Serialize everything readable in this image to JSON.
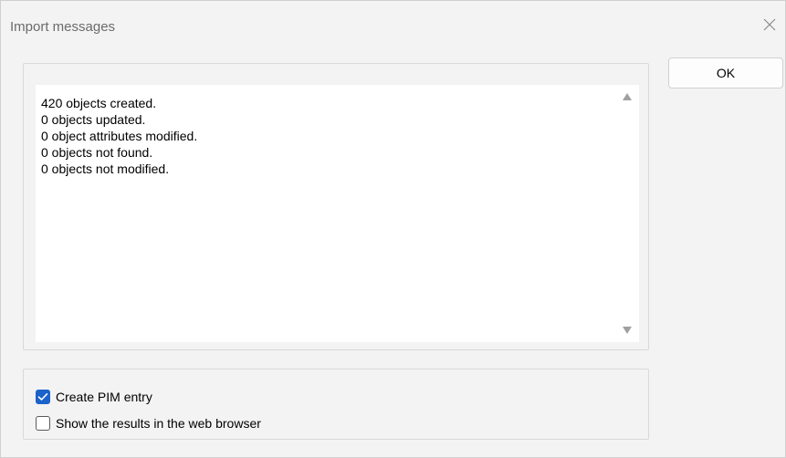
{
  "window": {
    "title": "Import messages",
    "close_icon": "close-icon"
  },
  "messages": {
    "lines": [
      "420 objects created.",
      "0 objects updated.",
      "0 object attributes modified.",
      "0 objects not found.",
      "0 objects not modified."
    ],
    "scroll_up_icon": "triangle-up-icon",
    "scroll_down_icon": "triangle-down-icon"
  },
  "buttons": {
    "ok_label": "OK"
  },
  "options": {
    "create_pim": {
      "label": "Create PIM entry",
      "checked": true
    },
    "show_web": {
      "label": "Show the results in the web browser",
      "checked": false
    }
  },
  "colors": {
    "checkbox_accent": "#1b63c9",
    "dialog_background": "#f3f3f3",
    "text": "#000000",
    "title_text": "#6b6b6b"
  }
}
